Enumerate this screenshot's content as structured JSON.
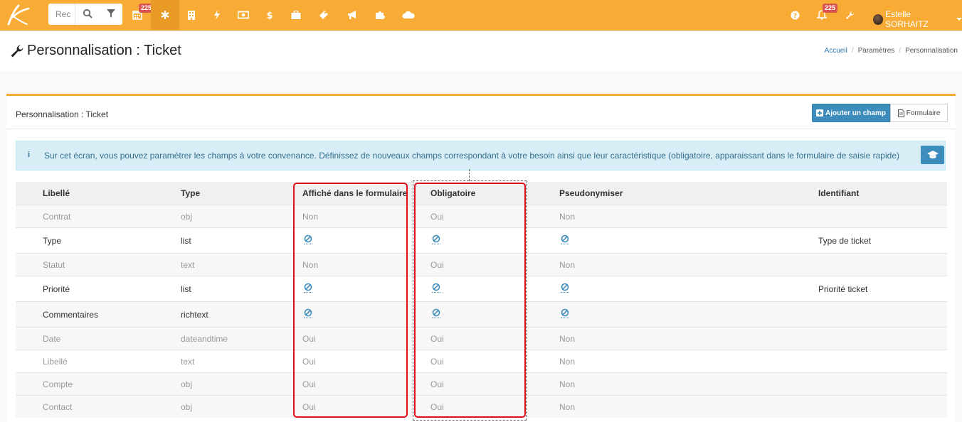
{
  "topbar": {
    "search_placeholder": "Rec",
    "badge_calendar": "225",
    "badge_bell": "225",
    "user_name": "Estelle SORHAITZ",
    "icons": [
      "calendar-icon",
      "asterisk-icon",
      "building-icon",
      "bolt-icon",
      "money-icon",
      "dollar-icon",
      "briefcase-icon",
      "ticket-icon",
      "bullhorn-icon",
      "puzzle-icon",
      "cloud-icon",
      "help-icon",
      "bell-icon",
      "wrench-icon"
    ]
  },
  "header": {
    "title": "Personnalisation : Ticket",
    "breadcrumb": [
      "Accueil",
      "Paramètres",
      "Personnalisation"
    ]
  },
  "panel": {
    "title": "Personnalisation : Ticket",
    "add_button": "Ajouter un champ",
    "form_button": "Formulaire"
  },
  "alert": {
    "icon": "i",
    "text": "Sur cet écran, vous pouvez paramétrer les champs à votre convenance. Définissez de nouveaux champs correspondant à votre besoin ainsi que leur caractéristique (obligatoire, apparaissant dans le formulaire de saisie rapide)"
  },
  "table": {
    "headers": [
      "Libellé",
      "Type",
      "Affiché dans le formulaire",
      "Obligatoire",
      "Pseudonymiser",
      "Identifiant"
    ],
    "rows": [
      {
        "label": "Contrat",
        "type": "obj",
        "shown": "Non",
        "required": "Oui",
        "pseudo": "Non",
        "ident": "",
        "editable": false
      },
      {
        "label": "Type",
        "type": "list",
        "shown": "ban",
        "required": "ban",
        "pseudo": "ban",
        "ident": "Type de ticket",
        "editable": true
      },
      {
        "label": "Statut",
        "type": "text",
        "shown": "Non",
        "required": "Oui",
        "pseudo": "Non",
        "ident": "",
        "editable": false
      },
      {
        "label": "Priorité",
        "type": "list",
        "shown": "ban",
        "required": "ban",
        "pseudo": "ban",
        "ident": "Priorité ticket",
        "editable": true
      },
      {
        "label": "Commentaires",
        "type": "richtext",
        "shown": "ban",
        "required": "ban",
        "pseudo": "ban",
        "ident": "",
        "editable": true
      },
      {
        "label": "Date",
        "type": "dateandtime",
        "shown": "Oui",
        "required": "Oui",
        "pseudo": "Non",
        "ident": "",
        "editable": false
      },
      {
        "label": "Libellé",
        "type": "text",
        "shown": "Oui",
        "required": "Oui",
        "pseudo": "Non",
        "ident": "",
        "editable": false
      },
      {
        "label": "Compte",
        "type": "obj",
        "shown": "Oui",
        "required": "Oui",
        "pseudo": "Non",
        "ident": "",
        "editable": false
      },
      {
        "label": "Contact",
        "type": "obj",
        "shown": "Oui",
        "required": "Oui",
        "pseudo": "Non",
        "ident": "",
        "editable": false
      }
    ]
  },
  "colors": {
    "topbar": "#f9ac35",
    "primary": "#3c8dbc",
    "highlight": "#e0101a",
    "badge": "#d9534f"
  }
}
